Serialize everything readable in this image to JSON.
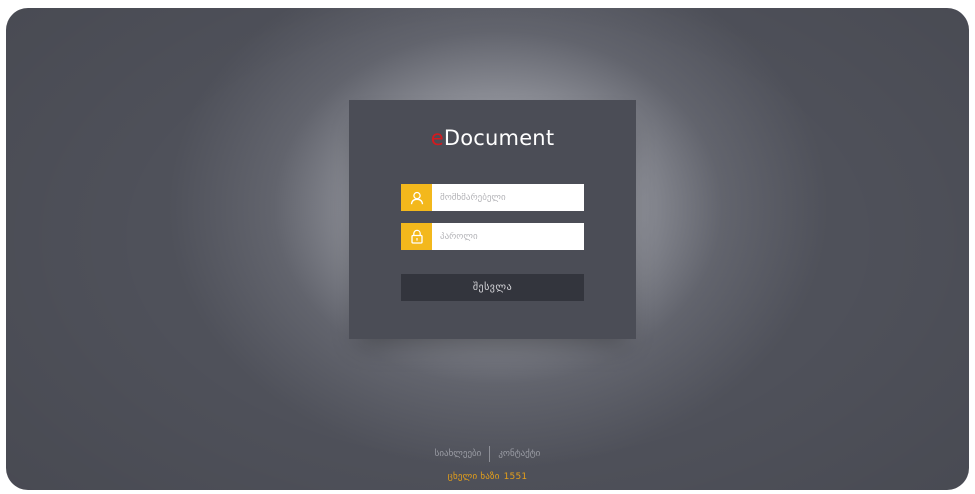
{
  "app": {
    "brand_prefix": "e",
    "brand_name": "Document"
  },
  "login": {
    "username_placeholder": "მომხმარებელი",
    "password_placeholder": "პაროლი",
    "submit_label": "შესვლა"
  },
  "footer": {
    "links": [
      "სიახლეები",
      "კონტაქტი"
    ],
    "hotline_label": "ცხელი ხაზი",
    "hotline_number": "1551"
  },
  "colors": {
    "accent": "#f3b81c",
    "brand_red": "#d21a1f",
    "panel": "#4b4d56",
    "button": "#33353d",
    "hotline": "#e8a21a"
  },
  "icons": {
    "username": "user-icon",
    "password": "lock-icon"
  }
}
